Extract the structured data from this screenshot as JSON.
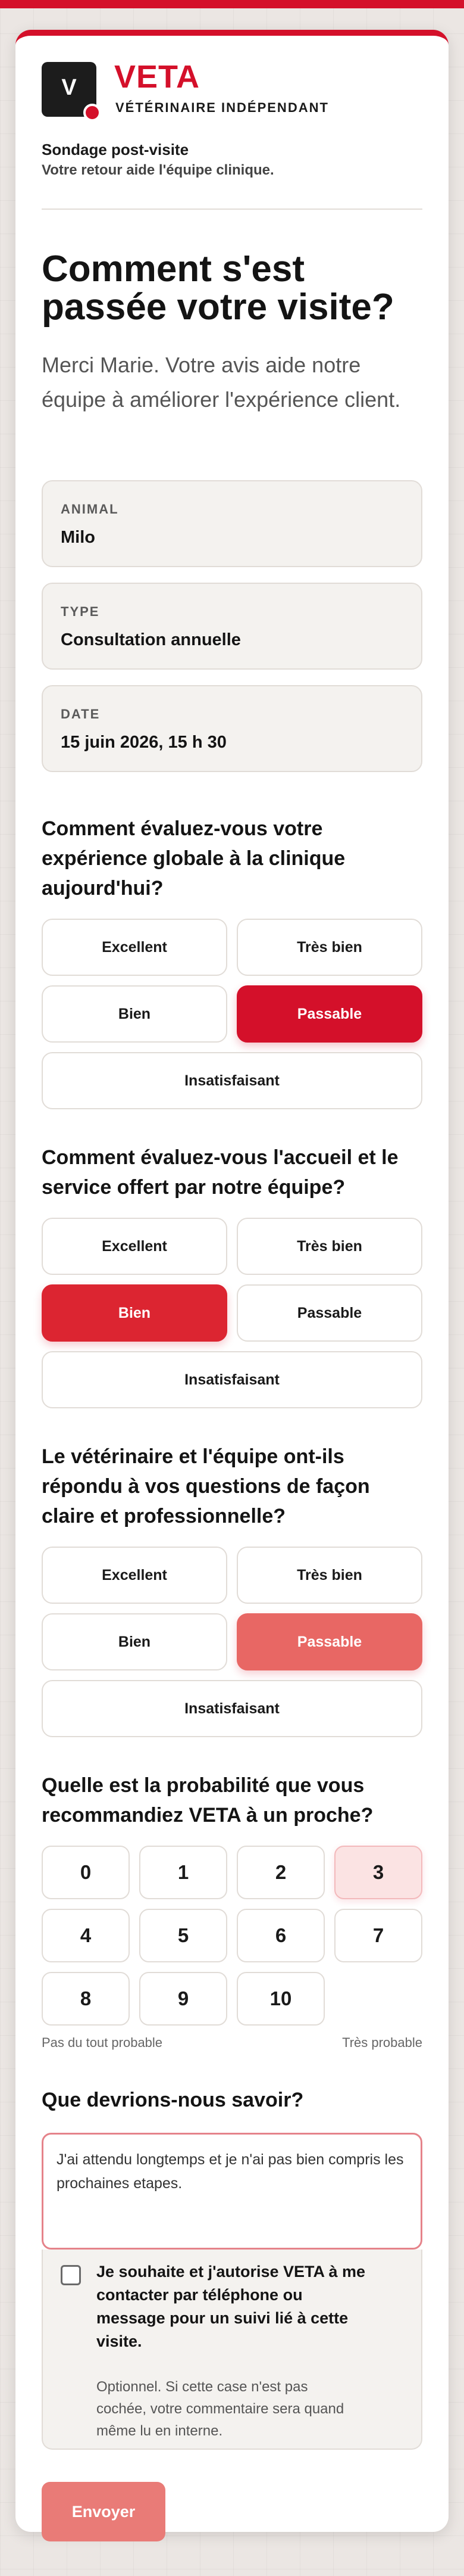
{
  "brand": {
    "logo_letter": "V",
    "name": "VETA",
    "tagline": "VÉTÉRINAIRE INDÉPENDANT"
  },
  "survey": {
    "title": "Sondage post-visite",
    "subtitle": "Votre retour aide l'équipe clinique."
  },
  "heading": {
    "line1": "Comment s'est",
    "line2": "passée votre visite?"
  },
  "lead": {
    "line1": "Merci Marie. Votre avis aide notre",
    "line2": "équipe à améliorer l'expérience client."
  },
  "details": [
    {
      "label": "ANIMAL",
      "value": "Milo"
    },
    {
      "label": "TYPE",
      "value": "Consultation annuelle"
    },
    {
      "label": "DATE",
      "value": "15 juin 2026, 15 h 30"
    }
  ],
  "rating_options": [
    "Excellent",
    "Très bien",
    "Bien",
    "Passable",
    "Insatisfaisant"
  ],
  "questions": [
    {
      "lines": [
        "Comment évaluez-vous votre",
        "expérience globale à la clinique",
        "aujourd'hui?"
      ],
      "selected": "Passable"
    },
    {
      "lines": [
        "Comment évaluez-vous l'accueil et le",
        "service offert par notre équipe?"
      ],
      "selected": "Bien"
    },
    {
      "lines": [
        "Le vétérinaire et l'équipe ont-ils",
        "répondu à vos questions de façon",
        "claire et professionnelle?"
      ],
      "selected": "Passable"
    }
  ],
  "nps": {
    "question_lines": [
      "Quelle est la probabilité que vous",
      "recommandiez VETA à un proche?"
    ],
    "values": [
      "0",
      "1",
      "2",
      "3",
      "4",
      "5",
      "6",
      "7",
      "8",
      "9",
      "10"
    ],
    "selected": "3",
    "low_label": "Pas du tout probable",
    "high_label": "Très probable"
  },
  "feedback": {
    "question": "Que devrions-nous savoir?",
    "value": "J'ai attendu longtemps et je n'ai pas bien compris les prochaines etapes."
  },
  "consent": {
    "text_lines": [
      "Je souhaite et j'autorise VETA à me",
      "contacter par téléphone ou",
      "message pour un suivi lié à cette",
      "visite."
    ],
    "note_lines": [
      "Optionnel. Si cette case n'est pas",
      "cochée, votre commentaire sera quand",
      "même lu en interne."
    ],
    "checked": false
  },
  "submit_label": "Envoyer",
  "colors": {
    "accent": "#d4102a",
    "selected_overall": "#d4102a",
    "selected_service": "#dc2531",
    "selected_clarity": "#e86764",
    "submit": "#e97b77"
  }
}
